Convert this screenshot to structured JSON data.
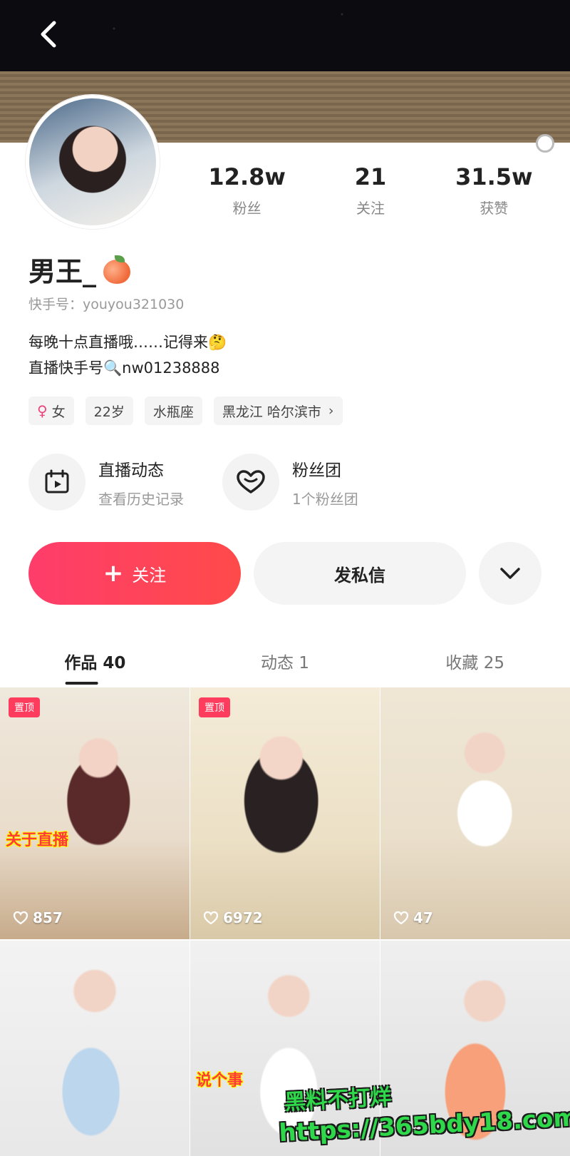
{
  "profile": {
    "name": "男王_",
    "kuaishou_id": "快手号：youyou321030",
    "bio_line1": "每晚十点直播哦……记得来🤔",
    "bio_line2": "直播快手号🔍nw01238888"
  },
  "stats": [
    {
      "value": "12.8w",
      "label": "粉丝"
    },
    {
      "value": "21",
      "label": "关注"
    },
    {
      "value": "31.5w",
      "label": "获赞"
    }
  ],
  "tags": {
    "gender": "女",
    "age": "22岁",
    "zodiac": "水瓶座",
    "location": "黑龙江 哈尔滨市"
  },
  "features": {
    "live": {
      "title": "直播动态",
      "subtitle": "查看历史记录"
    },
    "fans": {
      "title": "粉丝团",
      "subtitle": "1个粉丝团"
    }
  },
  "actions": {
    "follow": "关注",
    "message": "发私信"
  },
  "tabs": {
    "works": "作品 40",
    "moments": "动态 1",
    "favorites": "收藏 25"
  },
  "videos": [
    {
      "pinned": "置顶",
      "likes": "857",
      "caption": "关于直播"
    },
    {
      "pinned": "置顶",
      "likes": "6972",
      "caption": ""
    },
    {
      "pinned": "",
      "likes": "47",
      "caption": ""
    },
    {
      "pinned": "",
      "likes": "",
      "caption": ""
    },
    {
      "pinned": "",
      "likes": "",
      "caption": "说个事"
    },
    {
      "pinned": "",
      "likes": "",
      "caption": ""
    }
  ],
  "watermark": {
    "line1": "黑料不打烊",
    "line2": "https://365bdy18.com"
  },
  "colors": {
    "accent": "#fe3d6a",
    "female": "#e8457a",
    "watermark": "#2fd84a"
  },
  "icons": [
    "back-icon",
    "calendar-live-icon",
    "heart-fans-icon",
    "plus-icon",
    "chevron-down-icon",
    "heart-outline-icon",
    "female-icon",
    "chevron-right-icon"
  ]
}
